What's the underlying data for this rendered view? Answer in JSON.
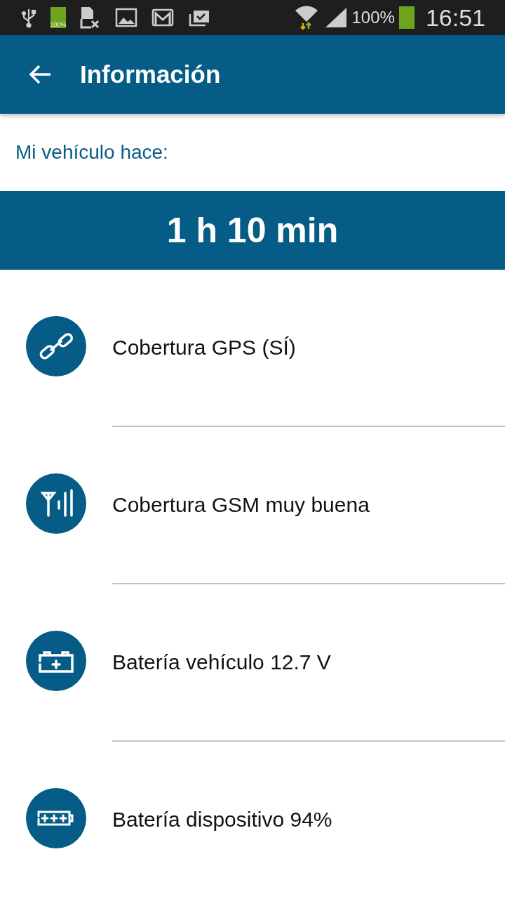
{
  "status_bar": {
    "battery_icon_text": "100%",
    "battery_percent": "100%",
    "time": "16:51"
  },
  "app_bar": {
    "title": "Información"
  },
  "label": "Mi vehículo hace:",
  "duration": "1 h 10 min",
  "items": [
    {
      "kind": "link",
      "text": "Cobertura GPS (SÍ)"
    },
    {
      "kind": "antenna",
      "text": "Cobertura GSM muy buena"
    },
    {
      "kind": "car-battery",
      "text": "Batería vehículo 12.7 V"
    },
    {
      "kind": "device-battery",
      "text": "Batería dispositivo 94%"
    }
  ]
}
